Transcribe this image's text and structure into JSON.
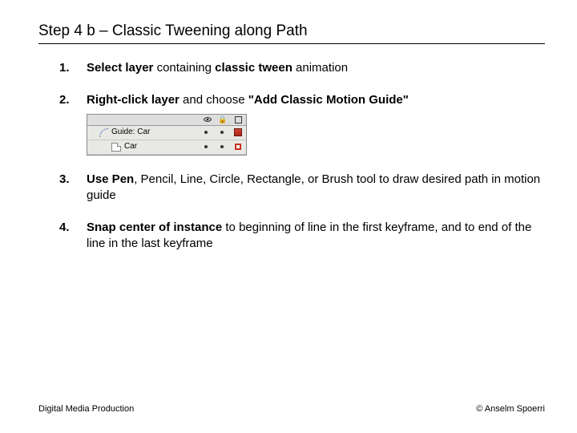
{
  "title": "Step 4 b – Classic Tweening along Path",
  "steps": {
    "s1": {
      "b1": "Select layer",
      "t1": " containing ",
      "b2": "classic tween",
      "t2": " animation"
    },
    "s2": {
      "b1": "Right-click layer",
      "t1": " and choose ",
      "b2": "\"Add Classic Motion Guide\""
    },
    "s3": {
      "b1": "Use Pen",
      "t1": ", Pencil, Line, Circle, Rectangle, or Brush tool to draw desired path in motion guide"
    },
    "s4": {
      "b1": "Snap center of instance",
      "t1": " to beginning of line in the first keyframe, and to end of the line in the last keyframe"
    }
  },
  "layers_panel": {
    "guide_label": "Guide: Car",
    "layer_label": "Car"
  },
  "footer": {
    "left": "Digital Media Production",
    "right": "© Anselm Spoerri"
  }
}
